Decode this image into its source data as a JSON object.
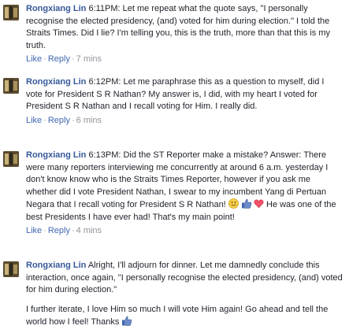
{
  "comments": [
    {
      "author": "Rongxiang Lin",
      "text": "6:11PM: Let me repeat what the quote says, \"I personally recognise the elected presidency, (and) voted for him during election.\" I told the Straits Times. Did I lie? I'm telling you, this is the truth, more than that this is my truth.",
      "like": "Like",
      "reply": "Reply",
      "time": "7 mins"
    },
    {
      "author": "Rongxiang Lin",
      "text": "6:12PM: Let me paraphrase this as a question to myself, did I vote for President S R Nathan? My answer is, I did, with my heart I voted for President S R Nathan and I recall voting for Him. I really did.",
      "like": "Like",
      "reply": "Reply",
      "time": "6 mins"
    },
    {
      "author": "Rongxiang Lin",
      "text_a": "6:13PM: Did the ST Reporter make a mistake? Answer: There were many reporters interviewing me concurrently at around 6 a.m. yesterday I don't know know who is the Straits Times Reporter, however if you ask me whether did I vote President Nathan, I swear to my incumbent Yang di Pertuan Negara that I recall voting for President S R Nathan!",
      "text_b": "He was one of the best Presidents I have ever had! That's my main point!",
      "like": "Like",
      "reply": "Reply",
      "time": "4 mins"
    },
    {
      "author": "Rongxiang Lin",
      "text": "Alright, I'll adjourn for dinner. Let me damnedly conclude this interaction, once again, \"I personally recognise the elected presidency, (and) voted for him during election.\"",
      "text_2": "I further iterate, I love Him so much I will vote Him again! Go ahead and tell the world how I feel! Thanks"
    }
  ],
  "separator": "·",
  "icons": [
    "smile-emoji-icon",
    "thumbs-up-icon",
    "heart-icon"
  ]
}
